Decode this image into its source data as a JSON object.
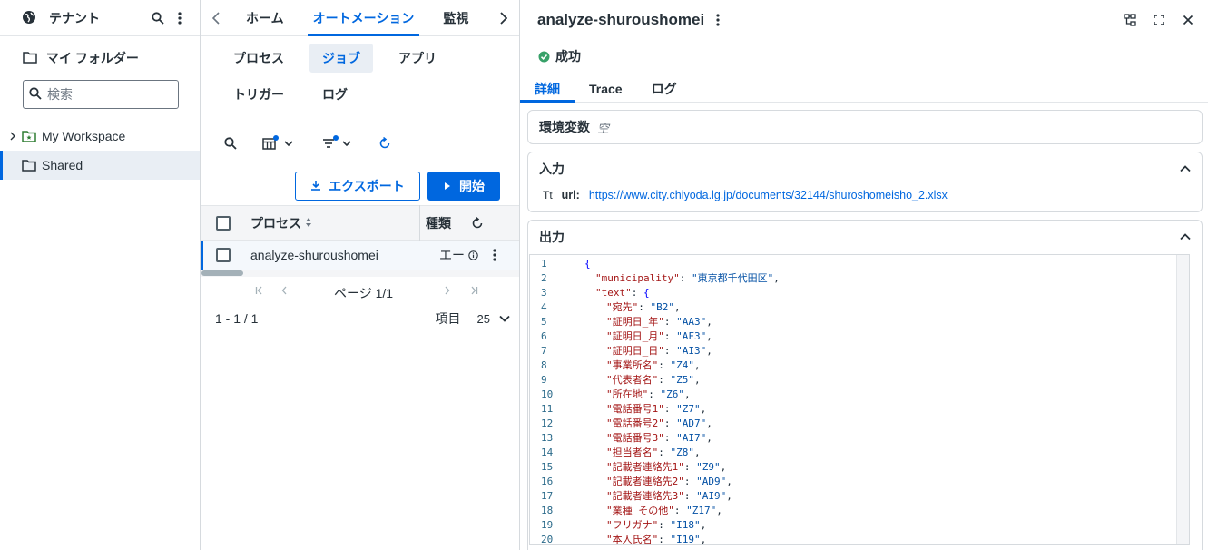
{
  "sidebar": {
    "tenant_label": "テナント",
    "folder_label": "マイ フォルダー",
    "search_placeholder": "検索",
    "tree": [
      {
        "label": "My Workspace"
      },
      {
        "label": "Shared"
      }
    ]
  },
  "nav": {
    "tabs": [
      {
        "label": "ホーム"
      },
      {
        "label": "オートメーション"
      },
      {
        "label": "監視"
      }
    ]
  },
  "subtabs": [
    {
      "label": "プロセス"
    },
    {
      "label": "ジョブ"
    },
    {
      "label": "アプリ"
    },
    {
      "label": "トリガー"
    },
    {
      "label": "ログ"
    }
  ],
  "actions": {
    "export_label": "エクスポート",
    "start_label": "開始"
  },
  "grid": {
    "columns": [
      {
        "label": "プロセス"
      },
      {
        "label": "種類"
      }
    ],
    "rows": [
      {
        "process": "analyze-shuroushomei",
        "type": "エー"
      }
    ],
    "page_label": "ページ 1/1",
    "range_label": "1 - 1 / 1",
    "items_label": "項目",
    "items_per_page": "25"
  },
  "detail": {
    "title": "analyze-shuroushomei",
    "status": "成功",
    "status_color": "#38a169",
    "tabs": [
      {
        "label": "詳細"
      },
      {
        "label": "Trace"
      },
      {
        "label": "ログ"
      }
    ],
    "env": {
      "label": "環境変数",
      "value": "空"
    },
    "input": {
      "label": "入力",
      "type_icon": "Tt",
      "key": "url:",
      "value": "https://www.city.chiyoda.lg.jp/documents/32144/shuroshomeisho_2.xlsx"
    },
    "output": {
      "label": "出力",
      "lines": [
        {
          "n": "1",
          "key": "",
          "val": "",
          "open": "{"
        },
        {
          "n": "2",
          "key": "\"municipality\"",
          "val": "\"東京都千代田区\"",
          "open": ""
        },
        {
          "n": "3",
          "key": "\"text\"",
          "val": "",
          "open": "{"
        },
        {
          "n": "4",
          "key": "\"宛先\"",
          "val": "\"B2\"",
          "open": ""
        },
        {
          "n": "5",
          "key": "\"証明日_年\"",
          "val": "\"AA3\"",
          "open": ""
        },
        {
          "n": "6",
          "key": "\"証明日_月\"",
          "val": "\"AF3\"",
          "open": ""
        },
        {
          "n": "7",
          "key": "\"証明日_日\"",
          "val": "\"AI3\"",
          "open": ""
        },
        {
          "n": "8",
          "key": "\"事業所名\"",
          "val": "\"Z4\"",
          "open": ""
        },
        {
          "n": "9",
          "key": "\"代表者名\"",
          "val": "\"Z5\"",
          "open": ""
        },
        {
          "n": "10",
          "key": "\"所在地\"",
          "val": "\"Z6\"",
          "open": ""
        },
        {
          "n": "11",
          "key": "\"電話番号1\"",
          "val": "\"Z7\"",
          "open": ""
        },
        {
          "n": "12",
          "key": "\"電話番号2\"",
          "val": "\"AD7\"",
          "open": ""
        },
        {
          "n": "13",
          "key": "\"電話番号3\"",
          "val": "\"AI7\"",
          "open": ""
        },
        {
          "n": "14",
          "key": "\"担当者名\"",
          "val": "\"Z8\"",
          "open": ""
        },
        {
          "n": "15",
          "key": "\"記載者連絡先1\"",
          "val": "\"Z9\"",
          "open": ""
        },
        {
          "n": "16",
          "key": "\"記載者連絡先2\"",
          "val": "\"AD9\"",
          "open": ""
        },
        {
          "n": "17",
          "key": "\"記載者連絡先3\"",
          "val": "\"AI9\"",
          "open": ""
        },
        {
          "n": "18",
          "key": "\"業種_その他\"",
          "val": "\"Z17\"",
          "open": ""
        },
        {
          "n": "19",
          "key": "\"フリガナ\"",
          "val": "\"I18\"",
          "open": ""
        },
        {
          "n": "20",
          "key": "\"本人氏名\"",
          "val": "\"I19\"",
          "open": ""
        }
      ]
    }
  },
  "colors": {
    "accent": "#0067df",
    "text": "#273139",
    "selected_bg": "#e9eef4"
  }
}
